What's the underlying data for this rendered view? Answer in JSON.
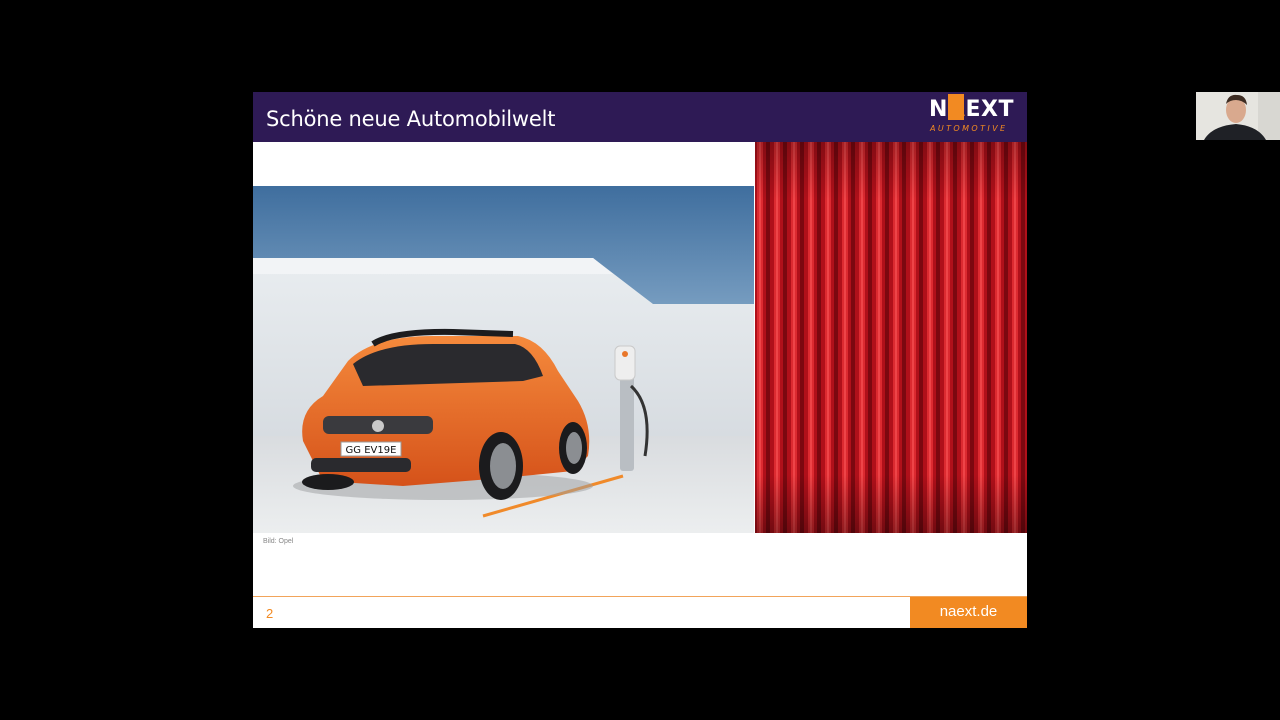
{
  "slide": {
    "title": "Schöne neue Automobilwelt",
    "logo": {
      "part1": "N",
      "part2": "A",
      "part3": "EXT",
      "tagline": "AUTOMOTIVE"
    },
    "car_plate": "GG EV19E",
    "image_credit": "Bild: Opel",
    "page_number": "2",
    "website": "naext.de"
  },
  "colors": {
    "header": "#2e1a55",
    "accent": "#f28a22",
    "curtain": "#c3111b",
    "car": "#ee6a24"
  }
}
